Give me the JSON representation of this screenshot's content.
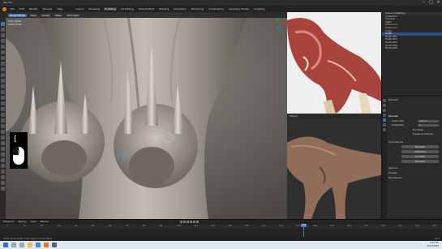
{
  "window": {
    "title": "Blender",
    "controls": [
      "–",
      "□",
      "✕"
    ]
  },
  "menubar": {
    "menus": [
      "File",
      "Edit",
      "Render",
      "Window",
      "Help"
    ],
    "workspaces": [
      "Layout",
      "Modeling",
      "Sculpting",
      "UV Editing",
      "Texture Paint",
      "Shading",
      "Animation",
      "Rendering",
      "Compositing",
      "Geometry Nodes",
      "Scripting"
    ],
    "active_workspace": "Sculpting"
  },
  "viewport": {
    "header_items": [
      "Sculpt Mode",
      "View",
      "Sculpt",
      "Mask",
      "Face Sets"
    ],
    "info_lines": [
      "User Persp",
      "(189) Tooth"
    ],
    "keystroke": "["
  },
  "ref_viewport": {
    "header": "Object"
  },
  "outliner": {
    "rows": [
      {
        "label": "Scene Collection",
        "style": ""
      },
      {
        "label": "Collection",
        "style": ""
      },
      {
        "label": "Camera",
        "style": ""
      },
      {
        "label": "Light",
        "style": ""
      },
      {
        "label": "Reference",
        "style": "orange"
      },
      {
        "label": "Reference",
        "style": "orange"
      },
      {
        "label": "T-Rex",
        "style": ""
      },
      {
        "label": "Tooth",
        "style": "sel"
      },
      {
        "label": "Tooth.001",
        "style": ""
      },
      {
        "label": "Tooth.002",
        "style": ""
      },
      {
        "label": "Tooth.003",
        "style": ""
      },
      {
        "label": "Tooth.004",
        "style": ""
      },
      {
        "label": "Tooth.005",
        "style": ""
      }
    ]
  },
  "properties": {
    "object_name": "Remesh",
    "panel_title": "Remesh",
    "voxel_size_label": "Voxel Size",
    "voxel_size_value": "0.01 m",
    "adaptivity_label": "Adaptivity",
    "adaptivity_value": "0",
    "fix_poles_label": "Fix Poles",
    "preserve_label": "Preserve Volume",
    "remesh_button": "Remesh",
    "sym_section": "Symmetrize",
    "optimize_label": "Optimize",
    "dyntopo_label": "Dyntopo",
    "remesh_label": "Remesh",
    "options_label": "Options",
    "display_label": "Display",
    "tools_label": "Workspace"
  },
  "timeline": {
    "header_items": [
      "Playback",
      "Keying",
      "View",
      "Marker"
    ],
    "ticks": [
      "0",
      "10",
      "20",
      "30",
      "40",
      "50",
      "60",
      "70",
      "80",
      "90",
      "100",
      "110",
      "120",
      "130",
      "140",
      "150",
      "160",
      "170",
      "180",
      "190",
      "200",
      "210",
      "220",
      "230",
      "240",
      "250"
    ],
    "current_frame": "189"
  },
  "statusbar": {
    "left": "Select       Move       Rotate View       Object Context Menu",
    "version": "3.1.0"
  },
  "taskbar": {
    "time": "3:53 PM",
    "date": "4/21/2022"
  },
  "colors": {
    "accent": "#4772b3",
    "selection": "#334d80",
    "blender_orange": "#e87d0d"
  }
}
